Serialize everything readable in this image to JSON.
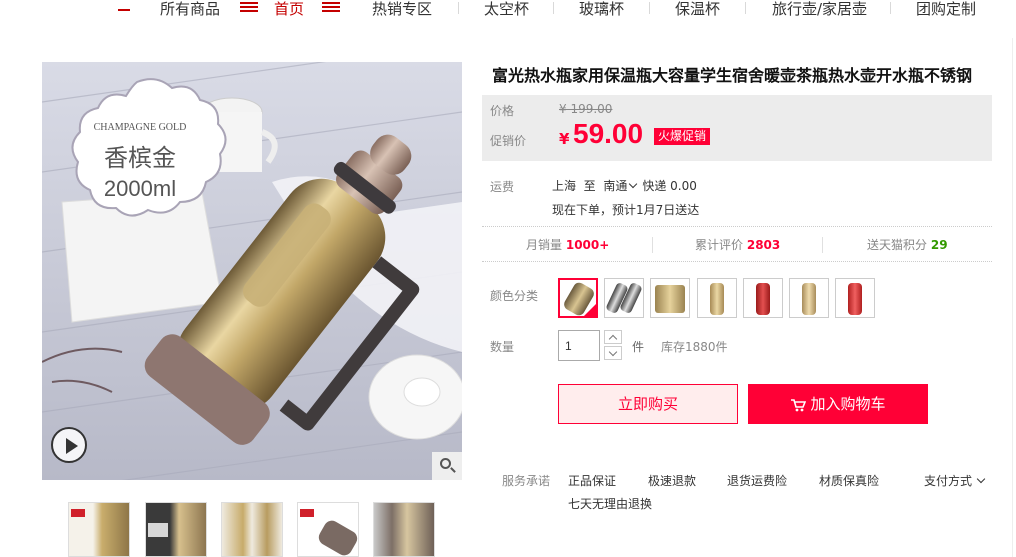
{
  "nav": {
    "items": [
      "所有商品",
      "首页",
      "热销专区",
      "太空杯",
      "玻璃杯",
      "保温杯",
      "旅行壶/家居壶",
      "团购定制"
    ]
  },
  "gallery": {
    "badge_en": "CHAMPAGNE GOLD",
    "badge_cn": "香槟金",
    "badge_vol": "2000ml"
  },
  "product": {
    "title": "富光热水瓶家用保温瓶大容量学生宿舍暖壶茶瓶热水壶开水瓶不锈钢",
    "price_label": "价格",
    "original_price": "¥ 199.00",
    "promo_label": "促销价",
    "currency": "¥",
    "promo_price": "59.00",
    "promo_tag": "火爆促销"
  },
  "shipping": {
    "label": "运费",
    "from": "上海",
    "to_word": "至",
    "to": "南通",
    "method": "快递 0.00",
    "delivery": "现在下单，预计1月7日送达"
  },
  "stats": {
    "monthly_label": "月销量",
    "monthly_value": "1000+",
    "reviews_label": "累计评价",
    "reviews_value": "2803",
    "points_label": "送天猫积分",
    "points_value": "29"
  },
  "options": {
    "color_label": "颜色分类",
    "qty_label": "数量",
    "qty_value": "1",
    "unit": "件",
    "stock": "库存1880件"
  },
  "actions": {
    "buy": "立即购买",
    "cart": "加入购物车"
  },
  "services": {
    "label": "服务承诺",
    "items": [
      "正品保证",
      "极速退款",
      "退货运费险",
      "材质保真险",
      "七天无理由退换"
    ],
    "payment": "支付方式"
  },
  "colors": {
    "accent": "#ff0036",
    "nav_accent": "#c40000"
  }
}
